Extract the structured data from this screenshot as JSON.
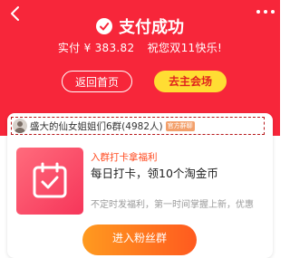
{
  "header": {
    "title": "支付成功",
    "paid_label": "实付",
    "paid_amount": "¥ 383.82",
    "greeting": "祝您双11快乐!",
    "back_icon": "chevron-left-icon",
    "more_icon": "more-dots-icon",
    "status_icon": "check-circle-icon"
  },
  "actions": {
    "home_label": "返回首页",
    "venue_label": "去主会场"
  },
  "group": {
    "name": "盛大的仙女姐姐们6群(4982人)",
    "tag": "官方群聊"
  },
  "benefit": {
    "title": "入群打卡拿福利",
    "desc": "每日打卡，领10个淘金币",
    "sub": "不定时发福利，第一时间掌握上新，优惠",
    "join_label": "进入粉丝群",
    "icon": "calendar-check-icon"
  },
  "colors": {
    "brand_red": "#f7263a",
    "accent_yellow": "#ffdd33",
    "accent_orange": "#ff7a1f"
  }
}
